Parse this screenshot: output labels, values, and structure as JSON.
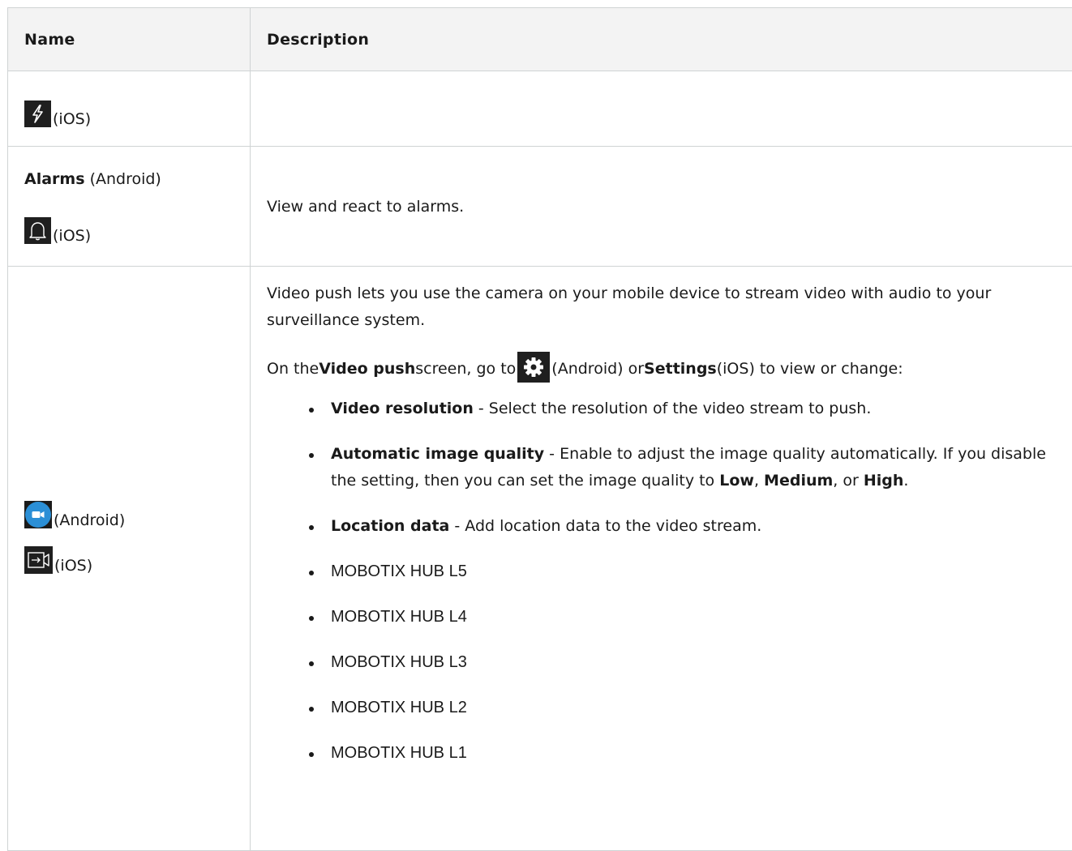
{
  "table": {
    "headers": {
      "name": "Name",
      "description": "Description"
    },
    "row1": {
      "icon": "lightning-icon",
      "name_suffix": "(iOS)",
      "description": ""
    },
    "row2": {
      "name_bold": "Alarms",
      "name_platform": "(Android)",
      "icon": "bell-icon",
      "icon_suffix": "(iOS)",
      "description": "View and react to alarms."
    },
    "row3": {
      "android_icon": "video-push-android-icon",
      "android_suffix": "(Android)",
      "ios_icon": "video-push-ios-icon",
      "ios_suffix": "(iOS)",
      "para1": "Video push lets you use the camera on your mobile device to stream video with audio to your surveillance system.",
      "para2": {
        "t1": "On the ",
        "b1": "Video push",
        "t2": " screen, go to ",
        "icon": "gear-icon",
        "t3": " (Android) or ",
        "b2": "Settings",
        "t4": " (iOS) to view or change:"
      },
      "items": {
        "resolution": {
          "bold": "Video resolution",
          "text": " - Select the resolution of the video stream to push."
        },
        "quality": {
          "bold": "Automatic image quality",
          "text1": " - Enable to adjust the image quality automatically. If you disable the setting, then you can set the image quality to ",
          "low": "Low",
          "sep1": ", ",
          "medium": "Medium",
          "sep2": ", or ",
          "high": "High",
          "end": "."
        },
        "location": {
          "bold": "Location data",
          "text": " - Add location data to the video stream."
        }
      },
      "hub_items": [
        "MOBOTIX HUB L5",
        "MOBOTIX HUB L4",
        "MOBOTIX HUB L3",
        "MOBOTIX HUB L2",
        "MOBOTIX HUB L1"
      ]
    }
  },
  "colors": {
    "header_bg": "#f3f3f3",
    "border": "#cfd3d4",
    "icon_bg": "#1f1f1f",
    "android_push_blue": "#2b8fd6"
  }
}
